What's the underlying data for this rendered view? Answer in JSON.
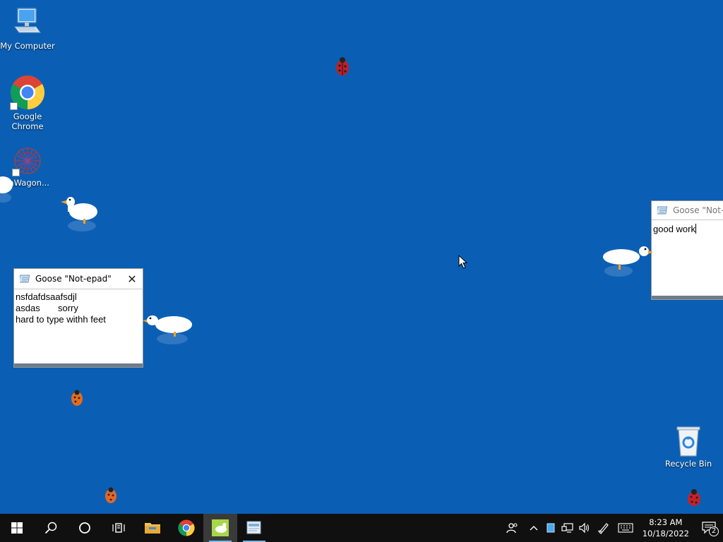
{
  "desktop": {
    "background_color": "#0a5fb4",
    "icons": [
      {
        "name": "my-computer",
        "label": "My Computer",
        "icon": "monitor-icon"
      },
      {
        "name": "google-chrome",
        "label": "Google Chrome",
        "icon": "chrome-icon"
      },
      {
        "name": "datawagon",
        "label": "taWagon...",
        "icon": "datawagon-icon"
      },
      {
        "name": "recycle-bin",
        "label": "Recycle Bin",
        "icon": "recycle-bin-icon"
      }
    ]
  },
  "notepads": {
    "left": {
      "title": "Goose \"Not-epad\"",
      "lines": [
        "nsfdafdsaafsdjl",
        "asdas       sorry",
        "hard to type withh feet"
      ]
    },
    "right": {
      "title": "Goose \"Not-e",
      "lines": [
        "good work"
      ]
    }
  },
  "taskbar": {
    "apps": [
      {
        "name": "start",
        "icon": "windows-logo-icon"
      },
      {
        "name": "search",
        "icon": "search-icon"
      },
      {
        "name": "cortana",
        "icon": "cortana-circle-icon"
      },
      {
        "name": "task-view",
        "icon": "task-view-icon"
      },
      {
        "name": "file-explorer",
        "icon": "folder-icon"
      },
      {
        "name": "chrome",
        "icon": "chrome-icon"
      },
      {
        "name": "goose",
        "icon": "goose-app-icon"
      },
      {
        "name": "notepad",
        "icon": "notepad-icon"
      }
    ],
    "tray": {
      "time": "8:23 AM",
      "date": "10/18/2022",
      "notification_count": "2"
    }
  }
}
